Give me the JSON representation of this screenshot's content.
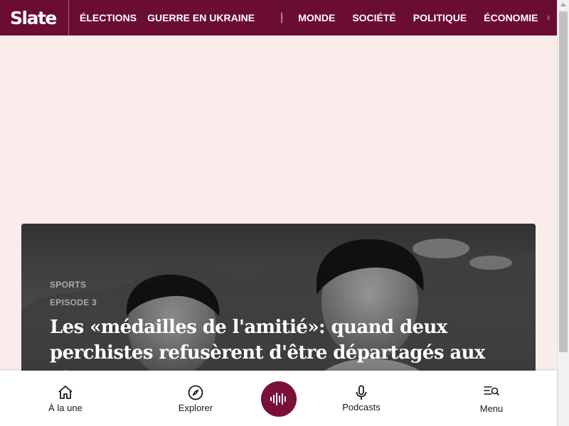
{
  "header": {
    "logo": "Slate",
    "nav": [
      "ÉLECTIONS",
      "GUERRE EN UKRAINE",
      "MONDE",
      "SOCIÉTÉ",
      "POLITIQUE",
      "ÉCONOMIE"
    ],
    "separator": "|",
    "more_chevron": "‹"
  },
  "article": {
    "category": "SPORTS",
    "episode": "EPISODE 3",
    "title": "Les «médailles de l'amitié»: quand deux perchistes refusèrent d'être départagés aux JO"
  },
  "bottom_nav": {
    "home": "À la une",
    "explore": "Explorer",
    "podcasts": "Podcasts",
    "menu": "Menu"
  },
  "colors": {
    "brand": "#6b0d33",
    "player": "#7a0f3a",
    "background": "#fbecec"
  },
  "icons": [
    "home-icon",
    "compass-icon",
    "audio-wave-icon",
    "microphone-icon",
    "menu-search-icon"
  ]
}
